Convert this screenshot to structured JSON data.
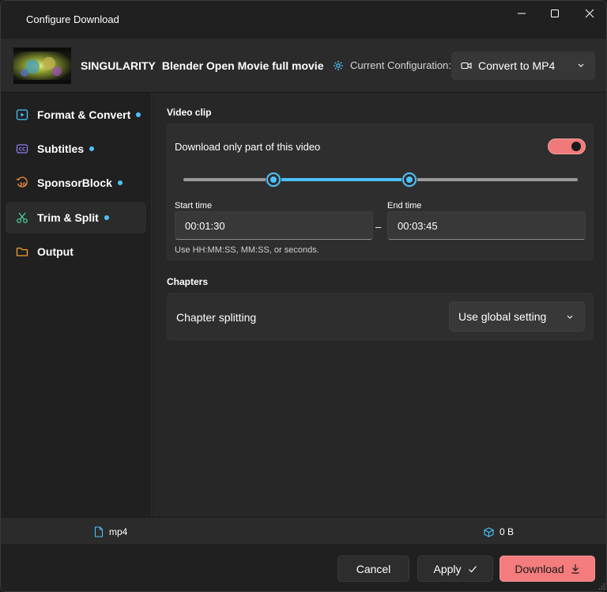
{
  "window": {
    "title": "Configure Download"
  },
  "header": {
    "channel": "SINGULARITY",
    "video_title": "Blender Open Movie full movie",
    "config_label": "Current Configuration:",
    "config_value": "Convert to MP4"
  },
  "sidebar": {
    "items": [
      {
        "label": "Format & Convert",
        "icon": "play-box-icon",
        "dot": true
      },
      {
        "label": "Subtitles",
        "icon": "cc-icon",
        "dot": true
      },
      {
        "label": "SponsorBlock",
        "icon": "rewind-30-icon",
        "dot": true
      },
      {
        "label": "Trim & Split",
        "icon": "scissors-icon",
        "dot": true,
        "active": true
      },
      {
        "label": "Output",
        "icon": "folder-icon",
        "dot": false
      }
    ]
  },
  "video_clip": {
    "section_title": "Video clip",
    "toggle_label": "Download only part of this video",
    "toggle_on": true,
    "start_label": "Start time",
    "start_value": "00:01:30",
    "end_label": "End time",
    "end_value": "00:03:45",
    "separator": "–",
    "hint": "Use HH:MM:SS, MM:SS, or seconds."
  },
  "chapters": {
    "section_title": "Chapters",
    "label": "Chapter splitting",
    "value": "Use global setting"
  },
  "status": {
    "format": "mp4",
    "size": "0 B"
  },
  "footer": {
    "cancel": "Cancel",
    "apply": "Apply",
    "download": "Download"
  },
  "colors": {
    "accent": "#4cc2ff",
    "primary_button": "#f47c7c",
    "toggle_on": "#f07a7a"
  }
}
